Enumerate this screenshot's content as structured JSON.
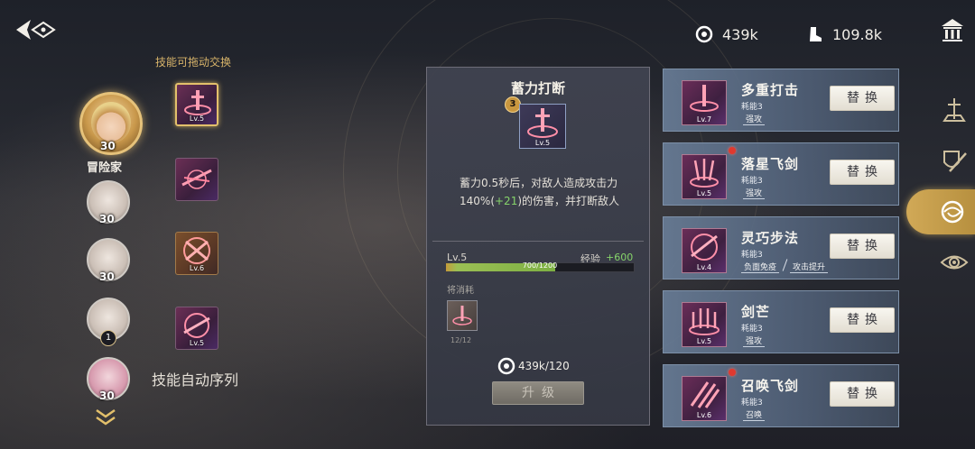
{
  "currencies": [
    {
      "icon": "coin-ring-icon",
      "value": "439k"
    },
    {
      "icon": "boot-icon",
      "value": "109.8k"
    }
  ],
  "left": {
    "swap_hint": "技能可拖动交换",
    "main_hero": {
      "name": "冒险家",
      "level": "30"
    },
    "other_heroes": [
      {
        "level": "30"
      },
      {
        "level": "30"
      },
      {
        "level": "1"
      },
      {
        "level": "30"
      }
    ],
    "skill_slots": [
      {
        "level": "Lv.5",
        "selected": true
      },
      {
        "level": "",
        "selected": false
      },
      {
        "level": "Lv.6",
        "selected": false
      },
      {
        "level": "Lv.5",
        "selected": false
      }
    ],
    "auto_sequence": "技能自动序列"
  },
  "detail": {
    "title": "蓄力打断",
    "badge": "3",
    "icon_level": "Lv.5",
    "desc_part1": "蓄力0.5秒后，对敌人造成攻击力1",
    "desc_part2": "40%(",
    "desc_bonus": "+21",
    "desc_part3": ")的伤害，并打断敌人",
    "level": "Lv.5",
    "xp_label": "经验",
    "xp_gain": "+600",
    "xp_text": "700/1200",
    "xp_fraction": 0.583,
    "consume_label": "将消耗",
    "material_count": "12/12",
    "cost": "439k/120",
    "upgrade_label": "升级"
  },
  "skill_list": [
    {
      "name": "多重打击",
      "cost": "耗能3",
      "tags": [
        "强攻"
      ],
      "level": "Lv.7",
      "new": false,
      "button": "替换"
    },
    {
      "name": "落星飞剑",
      "cost": "耗能3",
      "tags": [
        "强攻"
      ],
      "level": "Lv.5",
      "new": true,
      "button": "替换"
    },
    {
      "name": "灵巧步法",
      "cost": "耗能3",
      "tags": [
        "负面免疫",
        "攻击提升"
      ],
      "level": "Lv.4",
      "new": false,
      "button": "替换"
    },
    {
      "name": "剑芒",
      "cost": "耗能3",
      "tags": [
        "强攻"
      ],
      "level": "Lv.5",
      "new": false,
      "button": "替换"
    },
    {
      "name": "召唤飞剑",
      "cost": "耗能3",
      "tags": [
        "召唤"
      ],
      "level": "Lv.6",
      "new": true,
      "button": "替换"
    }
  ],
  "side_tabs": [
    "sword-altar-icon",
    "shield-sword-icon",
    "skill-swirl-icon",
    "eye-sigil-icon"
  ],
  "colors": {
    "accent_gold": "#d1a957",
    "bonus_green": "#86d36a",
    "new_dot": "#e0392f"
  }
}
